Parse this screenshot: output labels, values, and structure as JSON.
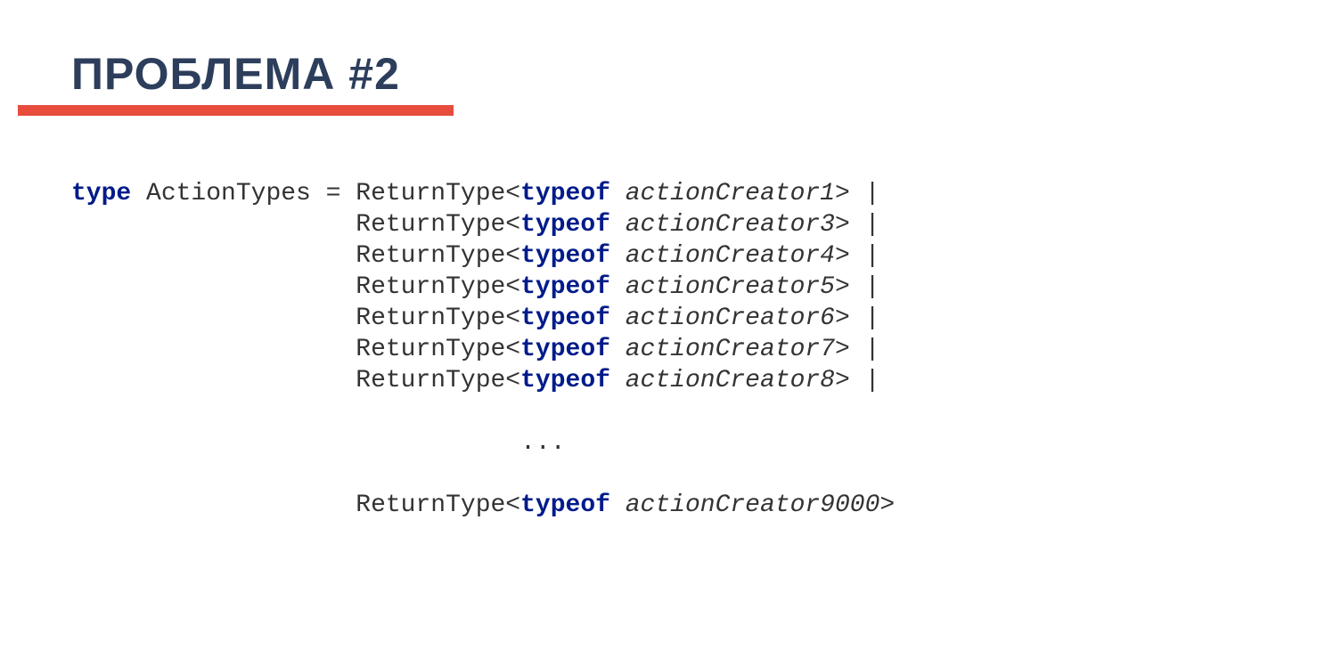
{
  "slide": {
    "title": "ПРОБЛЕМА #2"
  },
  "code": {
    "kw_type": "type",
    "kw_typeof": "typeof",
    "decl_name": " ActionTypes = ",
    "rt_open": "ReturnType<",
    "gt_pipe": "> |",
    "gt_close": ">",
    "creators": {
      "c1": "actionCreator1",
      "c3": "actionCreator3",
      "c4": "actionCreator4",
      "c5": "actionCreator5",
      "c6": "actionCreator6",
      "c7": "actionCreator7",
      "c8": "actionCreator8",
      "last": "actionCreator9000"
    },
    "indent": "                   ",
    "short_indent": "           ",
    "ellipsis": "...",
    "space": " "
  }
}
